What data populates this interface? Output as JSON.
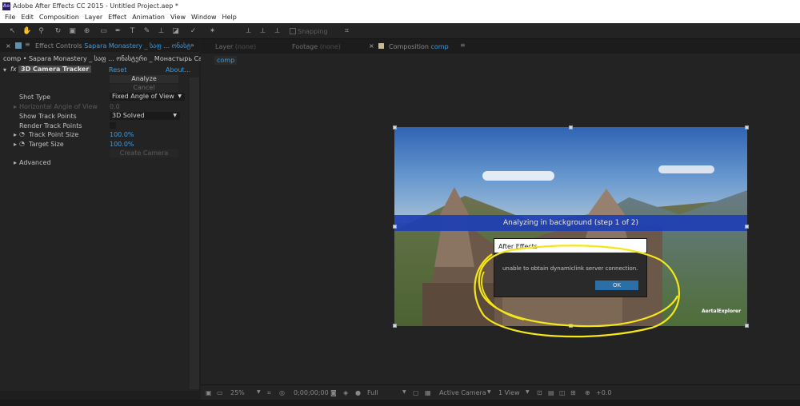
{
  "app": {
    "title": "Adobe After Effects CC 2015 - Untitled Project.aep *",
    "icon": "Ae"
  },
  "menu": [
    "File",
    "Edit",
    "Composition",
    "Layer",
    "Effect",
    "Animation",
    "View",
    "Window",
    "Help"
  ],
  "toolbar": {
    "snapping": "Snapping"
  },
  "left_panel": {
    "tab_prefix": "Effect Controls",
    "tab_layer": "Sapara Monastery _ საფ ... ონასტ",
    "breadcrumb": "comp • Sapara Monastery _ საფ ... ონასტერი _ Монастырь Сафара",
    "effect": {
      "name": "3D Camera Tracker",
      "reset": "Reset",
      "about": "About..."
    },
    "analyze": "Analyze",
    "cancel": "Cancel",
    "rows": [
      {
        "label": "Shot Type",
        "value": "Fixed Angle of View"
      },
      {
        "label": "Horizontal Angle of View",
        "value": "0.0"
      },
      {
        "label": "Show Track Points",
        "value": "3D Solved"
      },
      {
        "label": "Render Track Points",
        "value": ""
      },
      {
        "label": "Track Point Size",
        "value": "100.0%"
      },
      {
        "label": "Target Size",
        "value": "100.0%"
      }
    ],
    "create_camera": "Create Camera",
    "advanced": "Advanced"
  },
  "right_panel": {
    "tabs": [
      {
        "name": "Layer",
        "value": "(none)"
      },
      {
        "name": "Footage",
        "value": "(none)"
      },
      {
        "name": "Composition",
        "value": "comp"
      }
    ],
    "sub_tab": "comp",
    "viewer": {
      "banner": "Analyzing in background (step 1 of 2)",
      "watermark": "AertalExplorer"
    },
    "dialog": {
      "title": "After Effects",
      "message": "unable to obtain dynamiclink server connection.",
      "ok": "OK"
    },
    "bottom": {
      "zoom": "25%",
      "timecode": "0;00;00;00",
      "resolution": "Full",
      "camera": "Active Camera",
      "views": "1 View",
      "exposure": "+0.0"
    }
  },
  "colors": {
    "accent": "#3e9be0",
    "banner": "#1e3fb4",
    "scribble": "#f5e61a",
    "ok_button": "#2a6fa8"
  }
}
